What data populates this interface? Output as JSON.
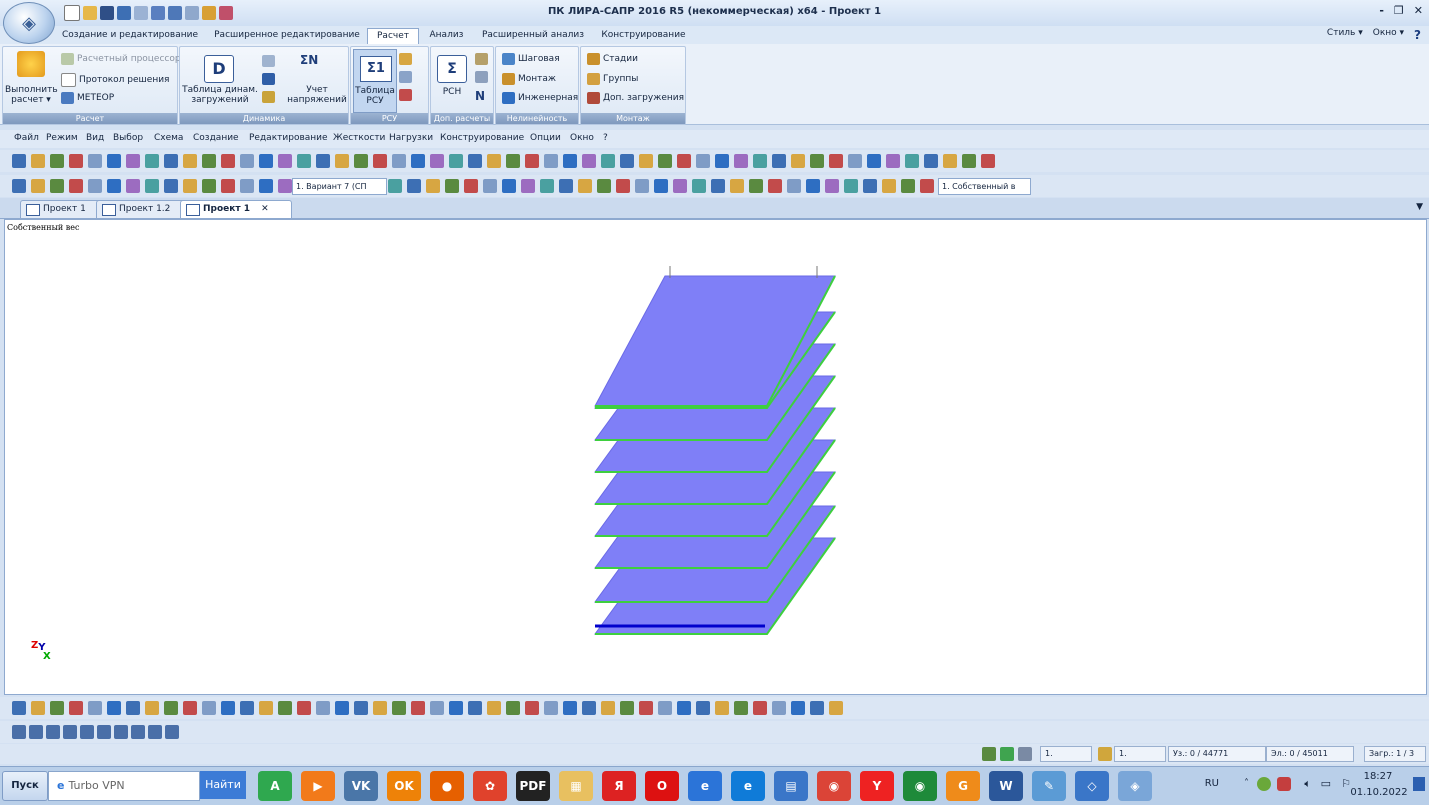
{
  "window": {
    "title": "ПК ЛИРА-САПР  2016 R5 (некоммерческая) x64 - Проект 1",
    "controls": [
      "-",
      "❐",
      "✕"
    ]
  },
  "ribbon_tabs": [
    "Создание и редактирование",
    "Расширенное редактирование",
    "Расчет",
    "Анализ",
    "Расширенный анализ",
    "Конструирование"
  ],
  "ribbon_right": {
    "style": "Стиль ▾",
    "window": "Окно ▾",
    "help": "?"
  },
  "ribbon": {
    "raschet": {
      "label": "Расчет",
      "run_line1": "Выполнить",
      "run_line2": "расчет ▾",
      "processor": "Расчетный процессор",
      "protocol": "Протокол решения",
      "meteor": "МЕТЕОР"
    },
    "dinamika": {
      "label": "Динамика",
      "table_line1": "Таблица динам.",
      "table_line2": "загружений",
      "stress_line1": "Учет",
      "stress_line2": "напряжений",
      "sigma": "ΣN"
    },
    "rsu": {
      "label": "РСУ",
      "line1": "Таблица",
      "line2": "РСУ",
      "icon": "Σ1"
    },
    "dop": {
      "label": "Доп. расчеты",
      "rsn": "РСН",
      "n": "N"
    },
    "nelin": {
      "label": "Нелинейность",
      "step": "Шаговая",
      "mount": "Монтаж",
      "eng": "Инженерная"
    },
    "montazh": {
      "label": "Монтаж",
      "stages": "Стадии",
      "groups": "Группы",
      "extra": "Доп. загружения"
    }
  },
  "menu": [
    "Файл",
    "Режим",
    "Вид",
    "Выбор",
    "Схема",
    "Создание",
    "Редактирование",
    "Жесткости",
    "Нагрузки",
    "Конструирование",
    "Опции",
    "Окно",
    "?"
  ],
  "toolbar2": {
    "variant": "1. Вариант 7 (СП",
    "load": "1. Собственный в"
  },
  "doc_tabs": [
    {
      "label": "Проект 1",
      "active": false
    },
    {
      "label": "Проект 1.2",
      "active": false
    },
    {
      "label": "Проект 1",
      "active": true
    }
  ],
  "doc_tab_close": "✕",
  "viewport": {
    "label": "Собственный вес",
    "axis_z": "Z",
    "axis_y": "Y",
    "axis_x": "X"
  },
  "status": {
    "combo1": "1.",
    "combo2": "1.",
    "nodes": "Уз.: 0 / 44771",
    "elements": "Эл.: 0 / 45011",
    "loads": "Загр.: 1 / 3"
  },
  "taskbar": {
    "start": "Пуск",
    "search": "Turbo VPN",
    "find": "Найти",
    "lang": "RU",
    "time": "18:27",
    "date": "01.10.2022"
  },
  "colors": {
    "slab": "#7f7ff7",
    "slab_edge": "#3ecf3e",
    "base": "#0000cc"
  }
}
